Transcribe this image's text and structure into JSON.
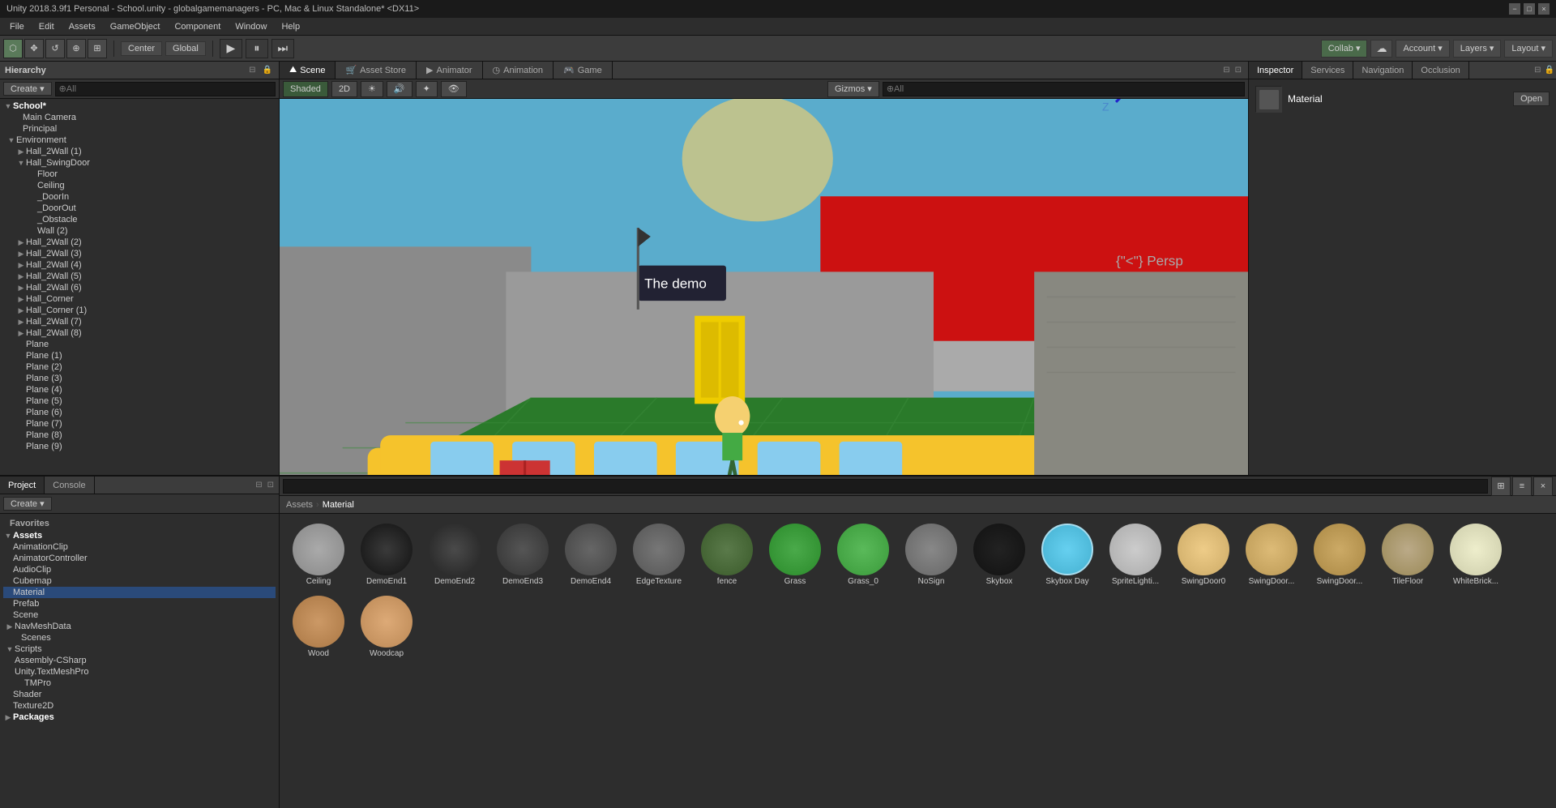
{
  "titlebar": {
    "title": "Unity 2018.3.9f1 Personal - School.unity - globalgamemanagers - PC, Mac & Linux Standalone* <DX11>",
    "minimize": "−",
    "maximize": "□",
    "close": "×"
  },
  "menubar": {
    "items": [
      "File",
      "Edit",
      "Assets",
      "GameObject",
      "Component",
      "Window",
      "Help"
    ]
  },
  "toolbar": {
    "tools": [
      "⬡",
      "✥",
      "↺",
      "⊕",
      "⊞"
    ],
    "center": "Center",
    "global": "Global",
    "play": "▶",
    "pause": "⏸",
    "step": "⏭",
    "collab": "Collab ▾",
    "cloud": "☁",
    "account": "Account ▾",
    "layers": "Layers ▾",
    "layout": "Layout ▾"
  },
  "hierarchy": {
    "title": "Hierarchy",
    "create_label": "Create ▾",
    "search_placeholder": "⊕All",
    "items": [
      {
        "indent": 0,
        "arrow": "▼",
        "label": "School*",
        "type": "scene"
      },
      {
        "indent": 1,
        "arrow": "",
        "label": "Main Camera",
        "type": "camera"
      },
      {
        "indent": 1,
        "arrow": "",
        "label": "Principal",
        "type": "object"
      },
      {
        "indent": 1,
        "arrow": "▼",
        "label": "Environment",
        "type": "folder"
      },
      {
        "indent": 2,
        "arrow": "▶",
        "label": "Hall_2Wall (1)",
        "type": "object"
      },
      {
        "indent": 2,
        "arrow": "▼",
        "label": "Hall_SwingDoor",
        "type": "object"
      },
      {
        "indent": 3,
        "arrow": "",
        "label": "Floor",
        "type": "object"
      },
      {
        "indent": 3,
        "arrow": "",
        "label": "Ceiling",
        "type": "object"
      },
      {
        "indent": 3,
        "arrow": "",
        "label": "_DoorIn",
        "type": "object"
      },
      {
        "indent": 3,
        "arrow": "",
        "label": "_DoorOut",
        "type": "object"
      },
      {
        "indent": 3,
        "arrow": "",
        "label": "_Obstacle",
        "type": "object"
      },
      {
        "indent": 3,
        "arrow": "",
        "label": "Wall (2)",
        "type": "object"
      },
      {
        "indent": 2,
        "arrow": "▶",
        "label": "Hall_2Wall (2)",
        "type": "object"
      },
      {
        "indent": 2,
        "arrow": "▶",
        "label": "Hall_2Wall (3)",
        "type": "object"
      },
      {
        "indent": 2,
        "arrow": "▶",
        "label": "Hall_2Wall (4)",
        "type": "object"
      },
      {
        "indent": 2,
        "arrow": "▶",
        "label": "Hall_2Wall (5)",
        "type": "object"
      },
      {
        "indent": 2,
        "arrow": "▶",
        "label": "Hall_2Wall (6)",
        "type": "object"
      },
      {
        "indent": 2,
        "arrow": "▶",
        "label": "Hall_Corner",
        "type": "object"
      },
      {
        "indent": 2,
        "arrow": "▶",
        "label": "Hall_Corner (1)",
        "type": "object"
      },
      {
        "indent": 2,
        "arrow": "▶",
        "label": "Hall_2Wall (7)",
        "type": "object"
      },
      {
        "indent": 2,
        "arrow": "▶",
        "label": "Hall_2Wall (8)",
        "type": "object"
      },
      {
        "indent": 2,
        "arrow": "",
        "label": "Plane",
        "type": "object"
      },
      {
        "indent": 2,
        "arrow": "",
        "label": "Plane (1)",
        "type": "object"
      },
      {
        "indent": 2,
        "arrow": "",
        "label": "Plane (2)",
        "type": "object"
      },
      {
        "indent": 2,
        "arrow": "",
        "label": "Plane (3)",
        "type": "object"
      },
      {
        "indent": 2,
        "arrow": "",
        "label": "Plane (4)",
        "type": "object"
      },
      {
        "indent": 2,
        "arrow": "",
        "label": "Plane (5)",
        "type": "object"
      },
      {
        "indent": 2,
        "arrow": "",
        "label": "Plane (6)",
        "type": "object"
      },
      {
        "indent": 2,
        "arrow": "",
        "label": "Plane (7)",
        "type": "object"
      },
      {
        "indent": 2,
        "arrow": "",
        "label": "Plane (8)",
        "type": "object"
      },
      {
        "indent": 2,
        "arrow": "",
        "label": "Plane (9)",
        "type": "object"
      }
    ]
  },
  "scene": {
    "tabs": [
      {
        "label": "Scene",
        "active": true,
        "icon": ""
      },
      {
        "label": "Asset Store",
        "active": false,
        "icon": ""
      },
      {
        "label": "Animator",
        "active": false,
        "icon": ""
      },
      {
        "label": "Animation",
        "active": false,
        "icon": ""
      },
      {
        "label": "Game",
        "active": false,
        "icon": ""
      }
    ],
    "shading": "Shaded",
    "mode": "2D",
    "gizmos": "Gizmos ▾",
    "search": "⊕All",
    "persp": "< Persp"
  },
  "inspector": {
    "tabs": [
      "Inspector",
      "Services",
      "Navigation",
      "Occlusion"
    ],
    "active_tab": "Inspector",
    "material_label": "Material",
    "open_btn": "Open"
  },
  "project": {
    "tabs": [
      "Project",
      "Console"
    ],
    "active_tab": "Project",
    "create_label": "Create ▾",
    "favorites_label": "Favorites",
    "assets_label": "Assets",
    "tree": [
      {
        "indent": 0,
        "arrow": "▼",
        "label": "Assets",
        "type": "folder"
      },
      {
        "indent": 1,
        "arrow": "",
        "label": "AnimationClip",
        "type": "folder"
      },
      {
        "indent": 1,
        "arrow": "",
        "label": "AnimatorController",
        "type": "folder"
      },
      {
        "indent": 1,
        "arrow": "",
        "label": "AudioClip",
        "type": "folder"
      },
      {
        "indent": 1,
        "arrow": "",
        "label": "Cubemap",
        "type": "folder"
      },
      {
        "indent": 1,
        "arrow": "",
        "label": "Material",
        "type": "folder",
        "selected": true
      },
      {
        "indent": 1,
        "arrow": "",
        "label": "Prefab",
        "type": "folder"
      },
      {
        "indent": 1,
        "arrow": "",
        "label": "Scene",
        "type": "folder"
      },
      {
        "indent": 1,
        "arrow": "▶",
        "label": "NavMeshData",
        "type": "folder"
      },
      {
        "indent": 2,
        "arrow": "",
        "label": "Scenes",
        "type": "folder"
      },
      {
        "indent": 1,
        "arrow": "▼",
        "label": "Scripts",
        "type": "folder"
      },
      {
        "indent": 2,
        "arrow": "",
        "label": "Assembly-CSharp",
        "type": "folder"
      },
      {
        "indent": 2,
        "arrow": "",
        "label": "Unity.TextMeshPro",
        "type": "folder"
      },
      {
        "indent": 3,
        "arrow": "",
        "label": "TMPro",
        "type": "folder"
      },
      {
        "indent": 1,
        "arrow": "",
        "label": "Shader",
        "type": "folder"
      },
      {
        "indent": 1,
        "arrow": "",
        "label": "Texture2D",
        "type": "folder"
      },
      {
        "indent": 0,
        "arrow": "▶",
        "label": "Packages",
        "type": "folder"
      }
    ]
  },
  "asset_browser": {
    "breadcrumb": [
      "Assets",
      "Material"
    ],
    "search_placeholder": "",
    "items": [
      {
        "name": "Ceiling",
        "color": "#888888",
        "type": "material"
      },
      {
        "name": "DemoEnd1",
        "color": "#222222",
        "type": "material"
      },
      {
        "name": "DemoEnd2",
        "color": "#333333",
        "type": "material"
      },
      {
        "name": "DemoEnd3",
        "color": "#444444",
        "type": "material"
      },
      {
        "name": "DemoEnd4",
        "color": "#555555",
        "type": "material"
      },
      {
        "name": "EdgeTexture",
        "color": "#666666",
        "type": "material"
      },
      {
        "name": "fence",
        "color": "#4a6a3a",
        "type": "material"
      },
      {
        "name": "Grass",
        "color": "#3a8a3a",
        "type": "material"
      },
      {
        "name": "Grass_0",
        "color": "#4a9a4a",
        "type": "material"
      },
      {
        "name": "NoSign",
        "color": "#777777",
        "type": "material"
      },
      {
        "name": "Skybox",
        "color": "#111111",
        "type": "material"
      },
      {
        "name": "Skybox Day",
        "color": "#4ac0e0",
        "type": "material"
      },
      {
        "name": "SpriteLighti...",
        "color": "#aaaaaa",
        "type": "material"
      },
      {
        "name": "SwingDoor0",
        "color": "#ddcc88",
        "type": "material"
      },
      {
        "name": "SwingDoor...",
        "color": "#ccaa66",
        "type": "material"
      },
      {
        "name": "SwingDoor...",
        "color": "#bb9944",
        "type": "material"
      },
      {
        "name": "TileFloor",
        "color": "#996633",
        "type": "material"
      },
      {
        "name": "WhiteBrick...",
        "color": "#ddddcc",
        "type": "material"
      },
      {
        "name": "Wood",
        "color": "#aa7744",
        "type": "material"
      },
      {
        "name": "Woodcap",
        "color": "#cc9955",
        "type": "material"
      }
    ]
  }
}
